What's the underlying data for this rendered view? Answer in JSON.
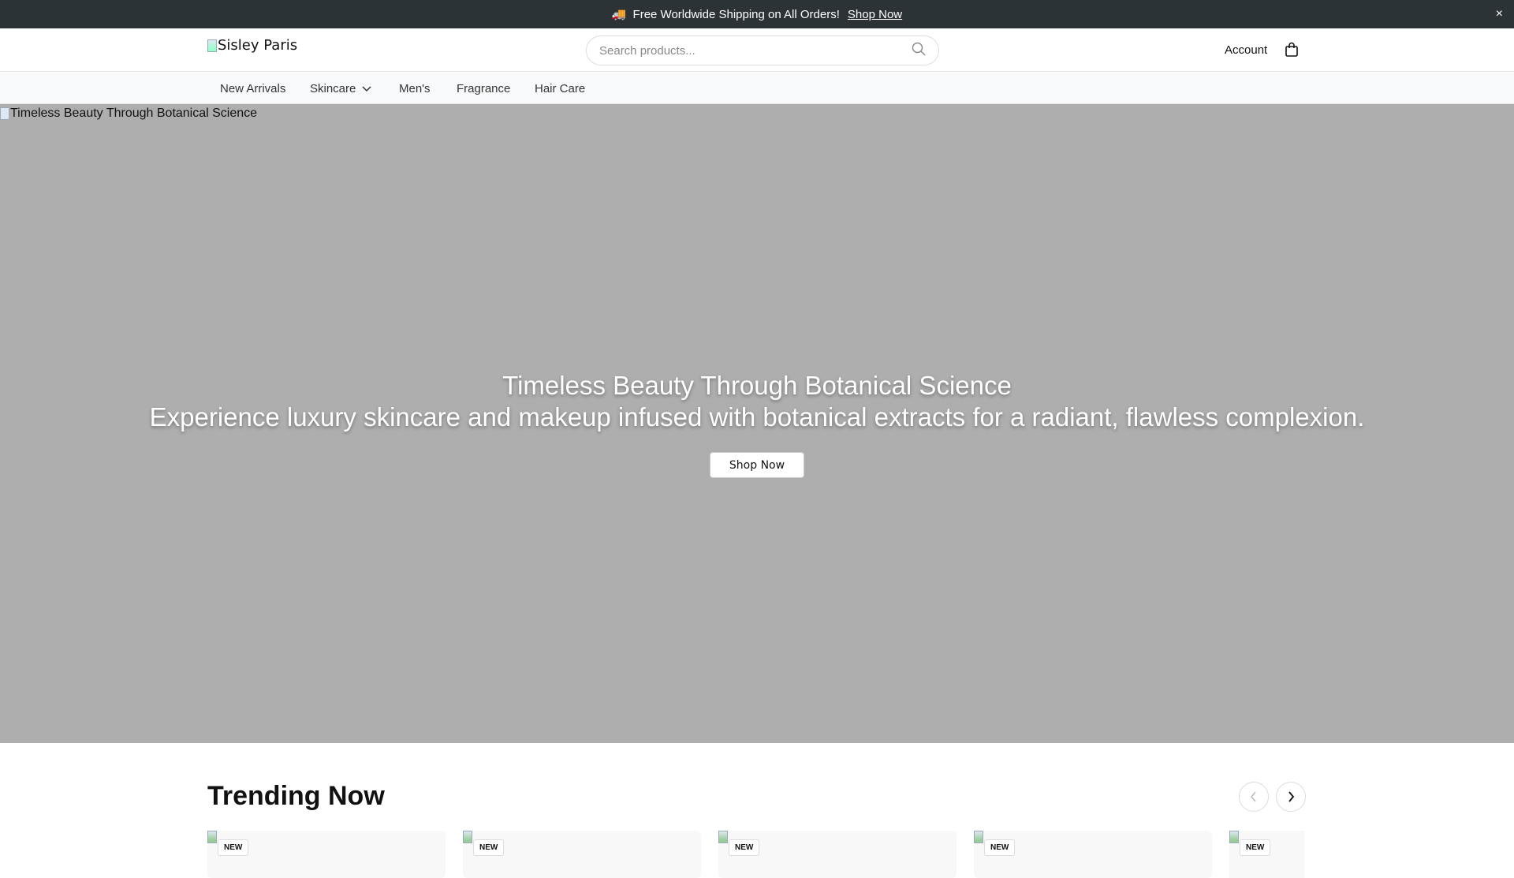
{
  "announcement": {
    "icon": "🚚",
    "text": "Free Worldwide Shipping on All Orders!",
    "link": "Shop Now",
    "close": "×"
  },
  "header": {
    "logo_alt": "Sisley Paris",
    "search_placeholder": "Search products...",
    "account": "Account"
  },
  "nav": {
    "items": [
      "New Arrivals",
      "Skincare",
      "Men's",
      "Fragrance",
      "Hair Care"
    ]
  },
  "hero": {
    "image_alt": "Timeless Beauty Through Botanical Science",
    "title": "Timeless Beauty Through Botanical Science",
    "subtitle": "Experience luxury skincare and makeup infused with botanical extracts for a radiant, flawless complexion.",
    "cta": "Shop Now"
  },
  "trending": {
    "title": "Trending Now",
    "cards": [
      {
        "badge": "NEW"
      },
      {
        "badge": "NEW"
      },
      {
        "badge": "NEW"
      },
      {
        "badge": "NEW"
      },
      {
        "badge": "NEW"
      }
    ]
  }
}
